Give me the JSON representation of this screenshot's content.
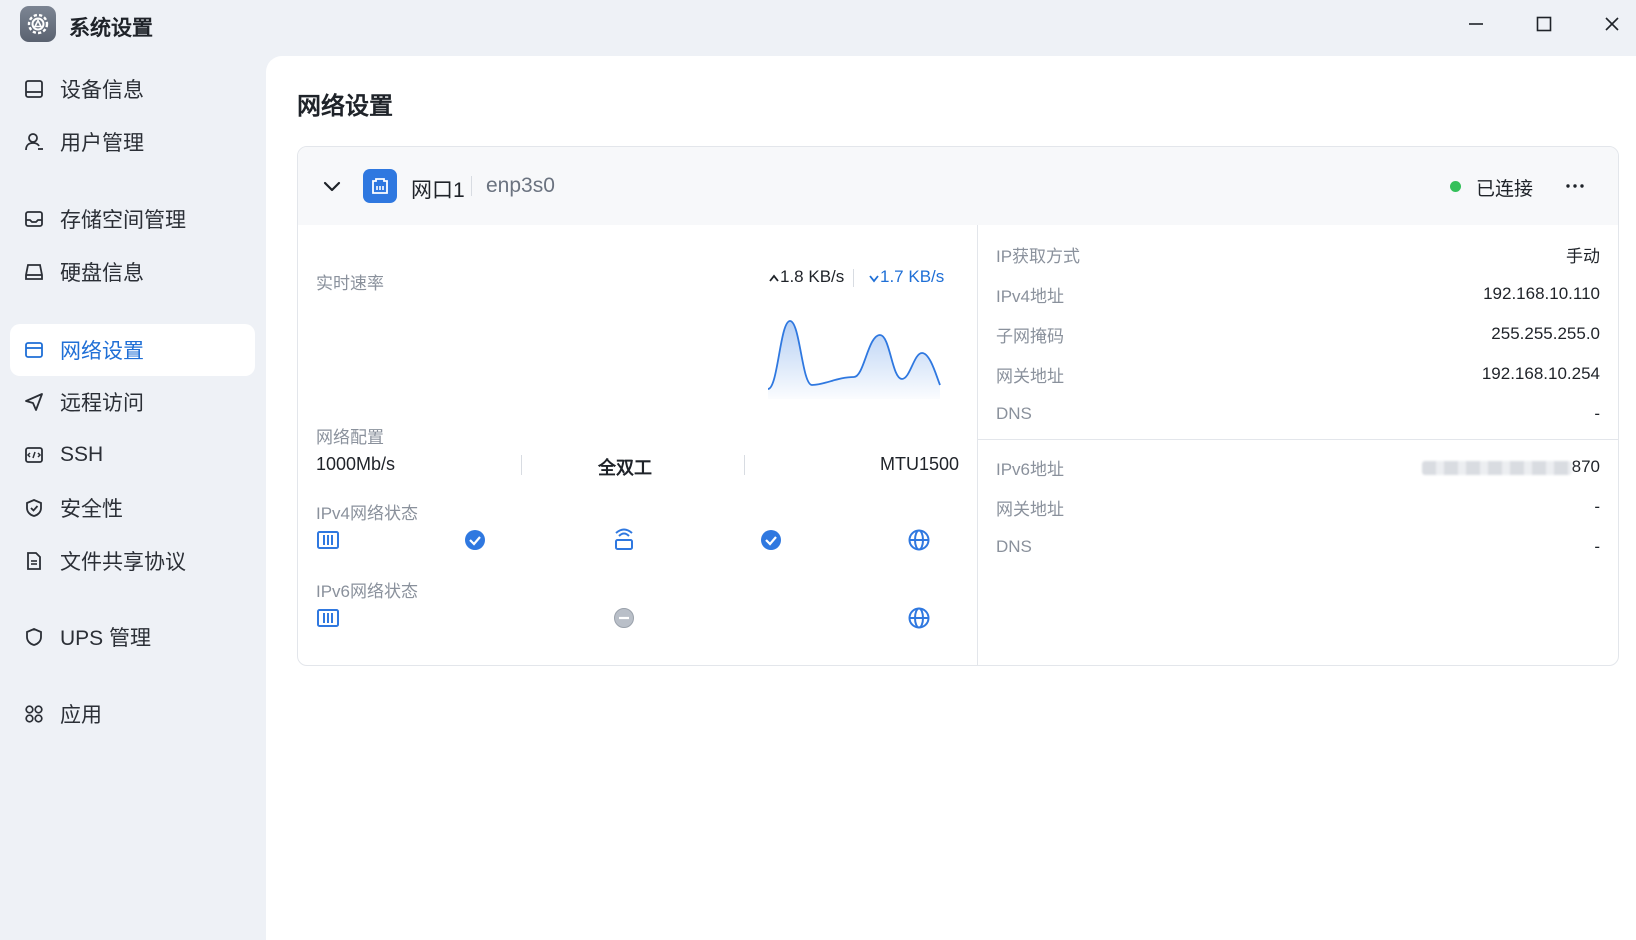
{
  "window": {
    "title": "系统设置"
  },
  "sidebar": {
    "items": [
      {
        "label": "设备信息",
        "icon": "device-icon"
      },
      {
        "label": "用户管理",
        "icon": "user-icon"
      },
      {
        "label": "存储空间管理",
        "icon": "storage-icon"
      },
      {
        "label": "硬盘信息",
        "icon": "disk-icon"
      },
      {
        "label": "网络设置",
        "icon": "network-icon",
        "active": true
      },
      {
        "label": "远程访问",
        "icon": "send-icon"
      },
      {
        "label": "SSH",
        "icon": "terminal-icon"
      },
      {
        "label": "安全性",
        "icon": "shield-check-icon"
      },
      {
        "label": "文件共享协议",
        "icon": "document-icon"
      },
      {
        "label": "UPS 管理",
        "icon": "shield-icon"
      },
      {
        "label": "应用",
        "icon": "apps-icon"
      }
    ]
  },
  "main": {
    "title": "网络设置",
    "interface": {
      "name": "网口1",
      "device": "enp3s0",
      "status": "已连接",
      "status_color": "#34c05a",
      "realtime": {
        "label": "实时速率",
        "upload": "1.8 KB/s",
        "download": "1.7 KB/s"
      },
      "config": {
        "label": "网络配置",
        "speed": "1000Mb/s",
        "duplex": "全双工",
        "mtu": "MTU1500"
      },
      "ipv4_status": {
        "label": "IPv4网络状态"
      },
      "ipv6_status": {
        "label": "IPv6网络状态"
      },
      "ipv4": [
        {
          "key": "IP获取方式",
          "value": "手动"
        },
        {
          "key": "IPv4地址",
          "value": "192.168.10.110"
        },
        {
          "key": "子网掩码",
          "value": "255.255.255.0"
        },
        {
          "key": "网关地址",
          "value": "192.168.10.254"
        },
        {
          "key": "DNS",
          "value": "-"
        }
      ],
      "ipv6": [
        {
          "key": "IPv6地址",
          "value": "870"
        },
        {
          "key": "网关地址",
          "value": "-"
        },
        {
          "key": "DNS",
          "value": "-"
        }
      ]
    }
  },
  "colors": {
    "accent": "#1f6fd6",
    "connected": "#34c05a"
  }
}
